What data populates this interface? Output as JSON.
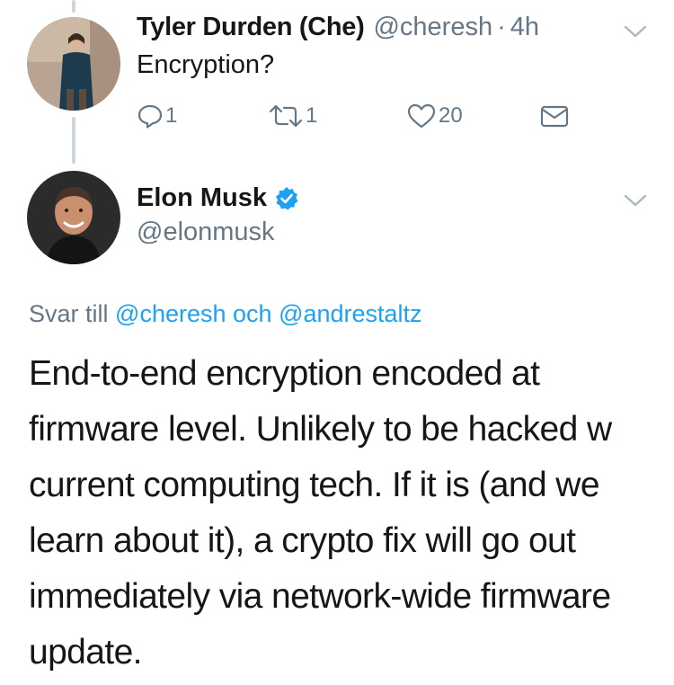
{
  "reply_tweet": {
    "author_name": "Tyler Durden (Che)",
    "author_handle": "@cheresh",
    "separator": "·",
    "time_ago": "4h",
    "text": "Encryption?",
    "actions": {
      "reply_count": "1",
      "retweet_count": "1",
      "like_count": "20"
    }
  },
  "main_tweet": {
    "author_name": "Elon Musk",
    "author_handle": "@elonmusk",
    "verified": true,
    "reply_prefix": "Svar till",
    "reply_mention_1": "@cheresh",
    "reply_joiner": "och",
    "reply_mention_2": "@andrestaltz",
    "text": "End-to-end encryption encoded at firmware level. Unlikely to be hacked w current computing tech. If it is (and we learn about it), a crypto fix will go out immediately via network-wide firmware update."
  },
  "icons": {
    "reply": "reply-icon",
    "retweet": "retweet-icon",
    "like": "heart-icon",
    "dm": "envelope-icon",
    "more": "chevron-down-icon",
    "verified": "verified-badge-icon"
  },
  "colors": {
    "text": "#14171a",
    "secondary": "#657786",
    "link": "#1da1f2",
    "thread_line": "#ccd6dd"
  }
}
